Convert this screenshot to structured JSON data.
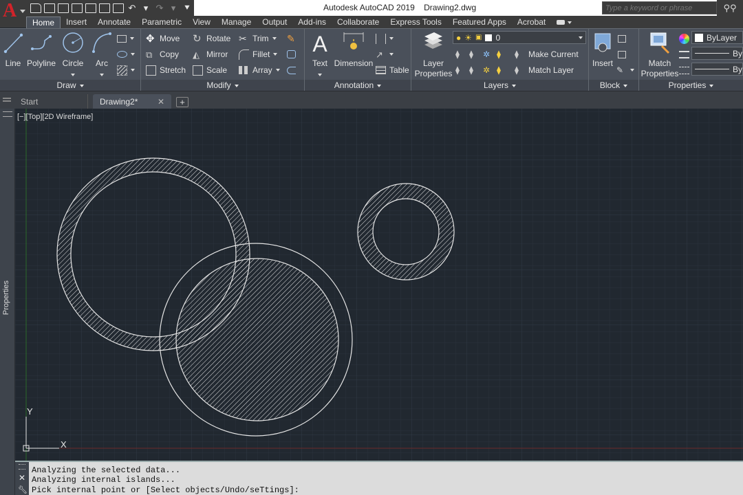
{
  "titlebar": {
    "title": "Autodesk AutoCAD 2019    Drawing2.dwg",
    "search_placeholder": "Type a keyword or phrase"
  },
  "ribbon_tabs": [
    "Home",
    "Insert",
    "Annotate",
    "Parametric",
    "View",
    "Manage",
    "Output",
    "Add-ins",
    "Collaborate",
    "Express Tools",
    "Featured Apps",
    "Acrobat"
  ],
  "active_tab": "Home",
  "panels": {
    "draw": {
      "title": "Draw",
      "line": "Line",
      "polyline": "Polyline",
      "circle": "Circle",
      "arc": "Arc"
    },
    "modify": {
      "title": "Modify",
      "move": "Move",
      "rotate": "Rotate",
      "trim": "Trim",
      "copy": "Copy",
      "mirror": "Mirror",
      "fillet": "Fillet",
      "stretch": "Stretch",
      "scale": "Scale",
      "array": "Array"
    },
    "annotation": {
      "title": "Annotation",
      "text": "Text",
      "dimension": "Dimension",
      "table": "Table"
    },
    "layers": {
      "title": "Layers",
      "layer_properties_1": "Layer",
      "layer_properties_2": "Properties",
      "current_layer": "0",
      "make_current": "Make Current",
      "match_layer": "Match Layer"
    },
    "block": {
      "title": "Block",
      "insert": "Insert"
    },
    "properties": {
      "title": "Properties",
      "match_1": "Match",
      "match_2": "Properties",
      "bylayer": "ByLayer",
      "by1": "By",
      "by2": "By"
    }
  },
  "file_tabs": {
    "start": "Start",
    "drawing": "Drawing2*"
  },
  "palette": {
    "label": "Properties"
  },
  "viewport": {
    "label": "[−][Top][2D Wireframe]"
  },
  "ucs": {
    "x": "X",
    "y": "Y"
  },
  "command_history": [
    "Analyzing the selected data...",
    "Analyzing internal islands...",
    "Pick internal point or [Select objects/Undo/seTtings]:"
  ],
  "colors": {
    "canvas": "#212830",
    "ribbon": "#4a505a",
    "hatch": "#e6e6e6",
    "ucs_x_axis": "#8a2a2a",
    "ucs_y_axis": "#2a7a2a"
  }
}
